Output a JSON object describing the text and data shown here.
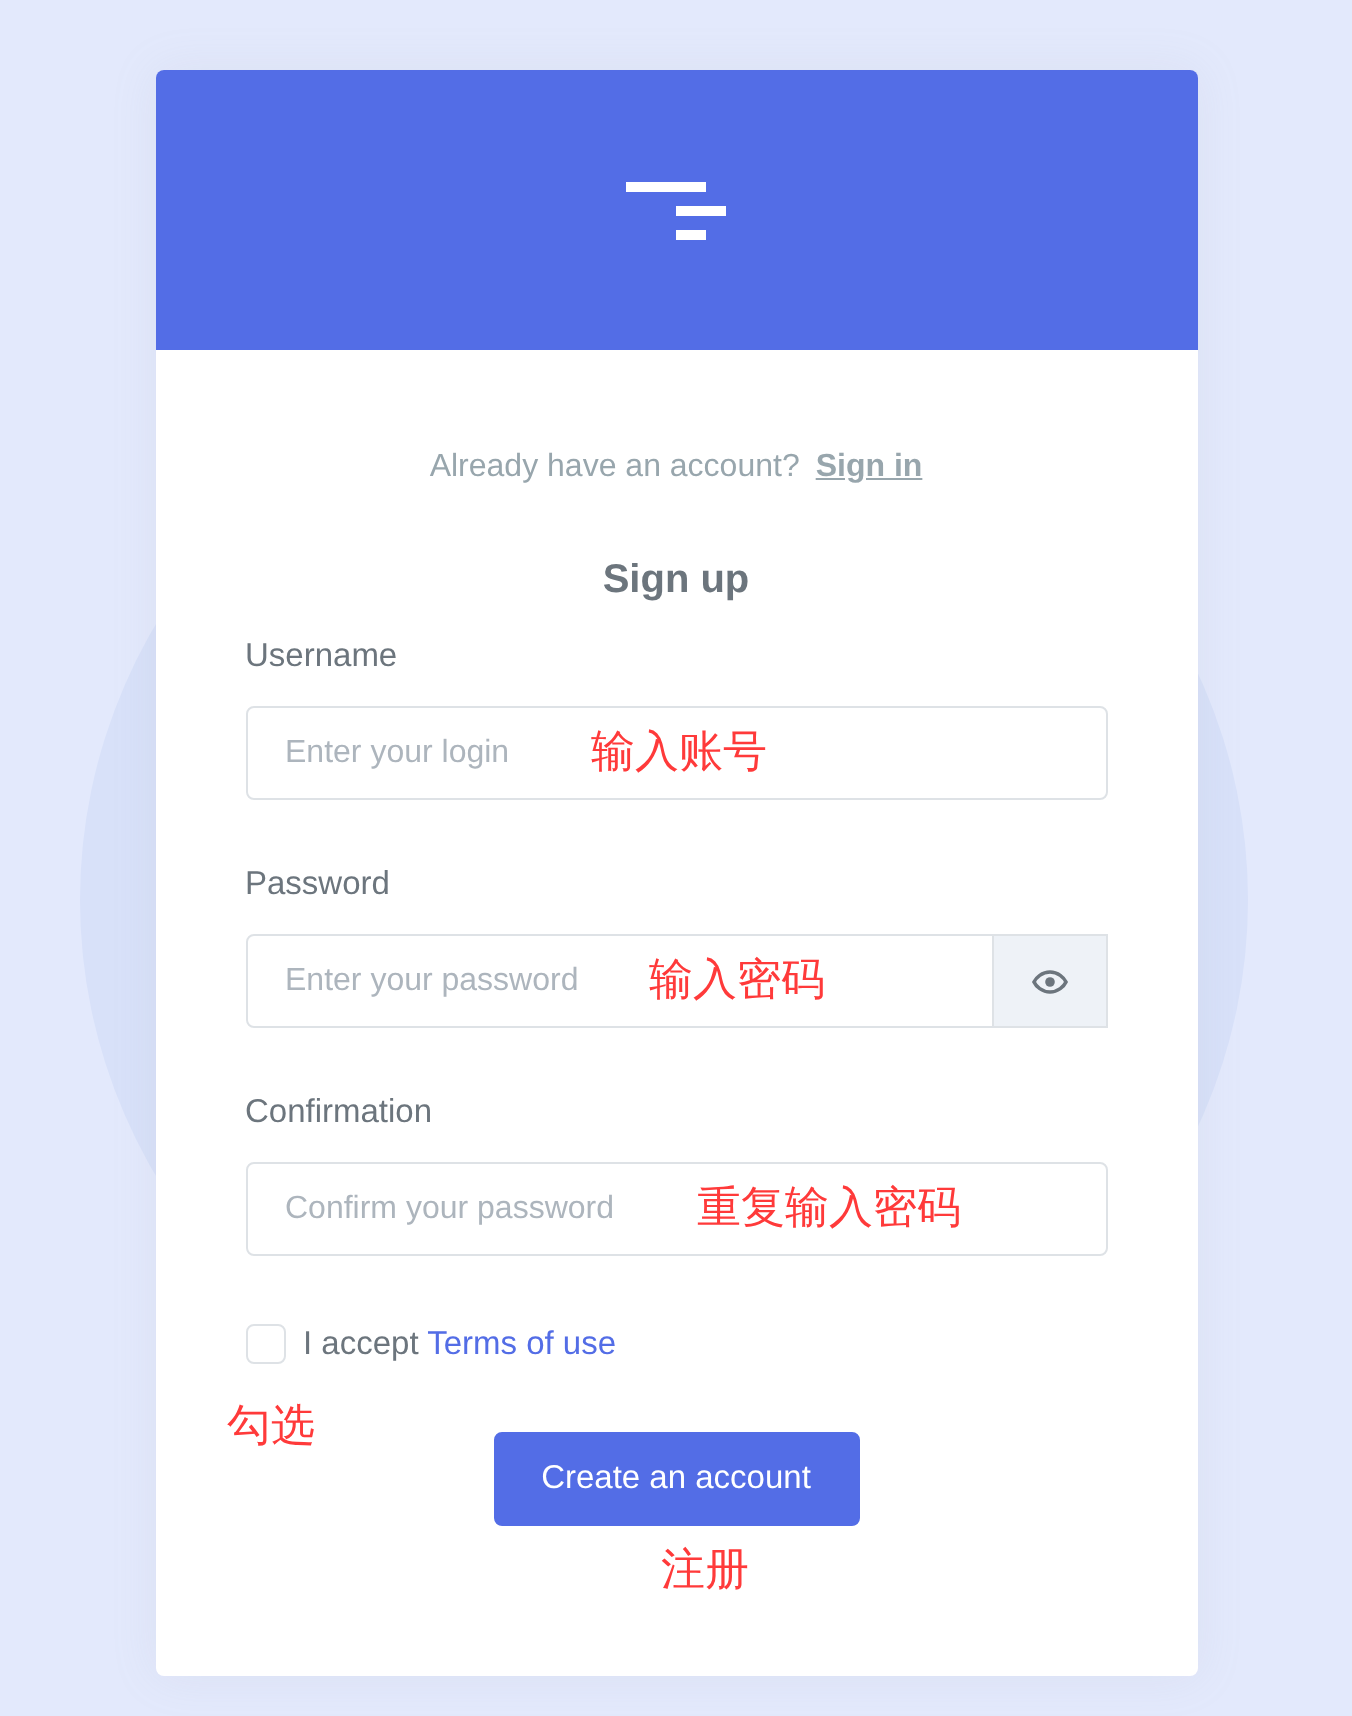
{
  "signin_prompt": {
    "text": "Already have an account?",
    "link": "Sign in"
  },
  "title": "Sign up",
  "fields": [
    {
      "kind": "text",
      "label": "Username",
      "placeholder": "Enter your login",
      "annotation": "输入账号"
    },
    {
      "kind": "password",
      "label": "Password",
      "placeholder": "Enter your password",
      "annotation": "输入密码"
    },
    {
      "kind": "text",
      "label": "Confirmation",
      "placeholder": "Confirm your password",
      "annotation": "重复输入密码"
    }
  ],
  "terms": {
    "checked": false,
    "text": "I accept",
    "link": "Terms of use",
    "annotation": "勾选"
  },
  "submit": {
    "label": "Create an account",
    "annotation": "注册"
  }
}
